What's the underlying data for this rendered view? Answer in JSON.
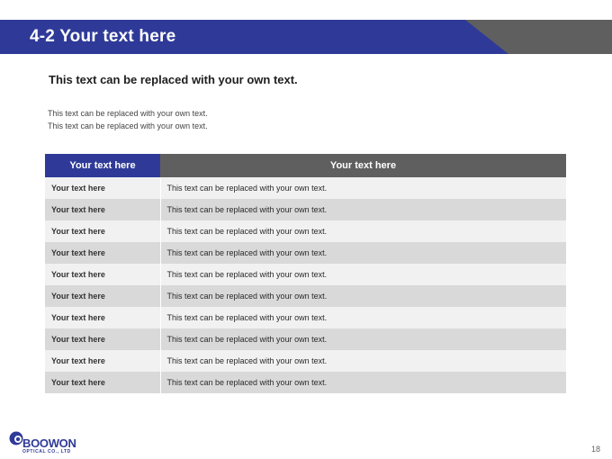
{
  "header": {
    "title": "4-2 Your text here"
  },
  "subtitle": "This text can be replaced with your own text.",
  "description": [
    "This text can be replaced with your own text.",
    "This text can be replaced with your own text."
  ],
  "table": {
    "headers": [
      "Your text here",
      "Your text here"
    ],
    "rows": [
      [
        "Your text here",
        "This text can be replaced with your own text."
      ],
      [
        "Your text here",
        "This text can be replaced with your own text."
      ],
      [
        "Your text here",
        "This text can be replaced with your own text."
      ],
      [
        "Your text here",
        "This text can be replaced with your own text."
      ],
      [
        "Your text here",
        "This text can be replaced with your own text."
      ],
      [
        "Your text here",
        "This text can be replaced with your own text."
      ],
      [
        "Your text here",
        "This text can be replaced with your own text."
      ],
      [
        "Your text here",
        "This text can be replaced with your own text."
      ],
      [
        "Your text here",
        "This text can be replaced with your own text."
      ],
      [
        "Your text here",
        "This text can be replaced with your own text."
      ]
    ]
  },
  "logo": {
    "name": "BOOWON",
    "subline": "OPTICAL CO., LTD"
  },
  "page_number": "18",
  "colors": {
    "accent_blue": "#2f3a98",
    "accent_gray": "#5f5f5f",
    "row_light": "#f1f1f1",
    "row_dark": "#d9d9d9"
  },
  "icons": {
    "logo_mark": "circle-logo-icon"
  }
}
